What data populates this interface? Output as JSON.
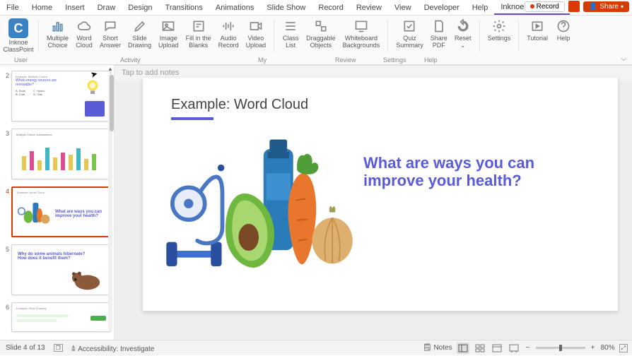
{
  "menu": {
    "file": "File",
    "home": "Home",
    "insert": "Insert",
    "draw": "Draw",
    "design": "Design",
    "transitions": "Transitions",
    "animations": "Animations",
    "slideshow": "Slide Show",
    "record": "Record",
    "review": "Review",
    "view": "View",
    "developer": "Developer",
    "help": "Help",
    "classpoint": "Inknoe ClassPoint"
  },
  "titlebar": {
    "record": "Record",
    "share": "Share"
  },
  "ribbon": {
    "user": {
      "classpoint": "Inknoe\nClassPoint",
      "label": "User"
    },
    "activity": {
      "mc": "Multiple\nChoice",
      "wc": "Word\nCloud",
      "sa": "Short\nAnswer",
      "sd": "Slide\nDrawing",
      "iu": "Image\nUpload",
      "fb": "Fill in the\nBlanks",
      "ar": "Audio\nRecord",
      "vu": "Video\nUpload",
      "label": "Activity"
    },
    "my": {
      "cl": "Class\nList",
      "do": "Draggable\nObjects",
      "wb": "Whiteboard\nBackgrounds",
      "label": "My"
    },
    "review": {
      "qs": "Quiz\nSummary",
      "sp": "Share\nPDF",
      "reset": "Reset",
      "label": "Review"
    },
    "settings": {
      "settings": "Settings",
      "label": "Settings"
    },
    "help": {
      "tutorial": "Tutorial",
      "help": "Help",
      "label": "Help"
    }
  },
  "thumbs": {
    "n2": "2",
    "n3": "3",
    "n4": "4",
    "n5": "5",
    "n6": "6",
    "t2_tag": "Example: Multiple Choice",
    "t2_q": "Which energy sources are\nrenewable?",
    "t2_opts": "A  Solar          C  Hydro\nB  Coal           D  Gas",
    "t3_tag": "Multiple Choice submissions",
    "t4_tag": "Example: Word Cloud",
    "t4_q": "What are ways you can\nimprove your health?",
    "t5_q": "Why do some animals hibernate?\nHow does it benefit them?",
    "t6_tag": "Example: Slide Drawing"
  },
  "slide": {
    "title": "Example: Word Cloud",
    "question": "What are ways you can improve your health?"
  },
  "notes": {
    "placeholder": "Tap to add notes"
  },
  "status": {
    "slide": "Slide 4 of 13",
    "access": "Accessibility: Investigate",
    "notes": "Notes",
    "zoom": "80%"
  }
}
